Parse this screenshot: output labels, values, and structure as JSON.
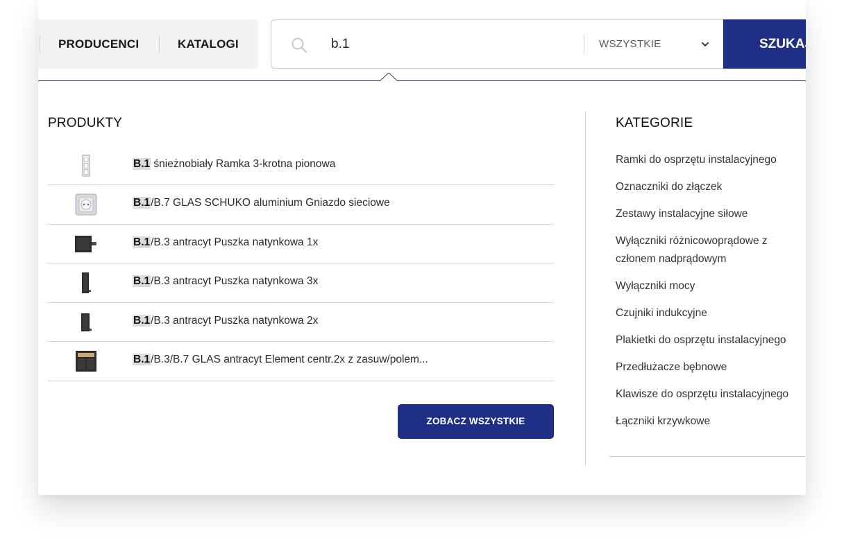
{
  "nav": {
    "links": [
      "PRODUCENCI",
      "KATALOGI"
    ]
  },
  "search": {
    "value": "b.1",
    "scope_label": "WSZYSTKIE",
    "button_label": "SZUKAJ"
  },
  "products": {
    "title": "PRODUKTY",
    "items": [
      {
        "highlight": "B.1",
        "rest": " śnieżnobiały Ramka 3-krotna pionowa",
        "thumb": "frame-3x-white"
      },
      {
        "highlight": "B.1",
        "rest": "/B.7 GLAS SCHUKO aluminium Gniazdo sieciowe",
        "thumb": "socket-aluminium"
      },
      {
        "highlight": "B.1",
        "rest": "/B.3 antracyt Puszka natynkowa 1x",
        "thumb": "box-1x-anthracite"
      },
      {
        "highlight": "B.1",
        "rest": "/B.3 antracyt Puszka natynkowa 3x",
        "thumb": "box-3x-anthracite"
      },
      {
        "highlight": "B.1",
        "rest": "/B.3 antracyt Puszka natynkowa 2x",
        "thumb": "box-2x-anthracite"
      },
      {
        "highlight": "B.1",
        "rest": "/B.3/B.7 GLAS antracyt Element centr.2x z zasuw/polem...",
        "thumb": "central-element-2x"
      }
    ],
    "see_all_label": "ZOBACZ WSZYSTKIE"
  },
  "categories": {
    "title": "KATEGORIE",
    "items": [
      "Ramki do osprzętu instalacyjnego",
      "Oznaczniki do złączek",
      "Zestawy instalacyjne siłowe",
      "Wyłączniki różnicowoprądowe z członem nadprądowym",
      "Wyłączniki mocy",
      "Czujniki indukcyjne",
      "Plakietki do osprzętu instalacyjnego",
      "Przedłużacze bębnowe",
      "Klawisze do osprzętu instalacyjnego",
      "Łączniki krzywkowe"
    ]
  },
  "colors": {
    "accent": "#1e2f85",
    "highlight_bg": "#dcdcdc",
    "divider": "#d6d6d6"
  }
}
